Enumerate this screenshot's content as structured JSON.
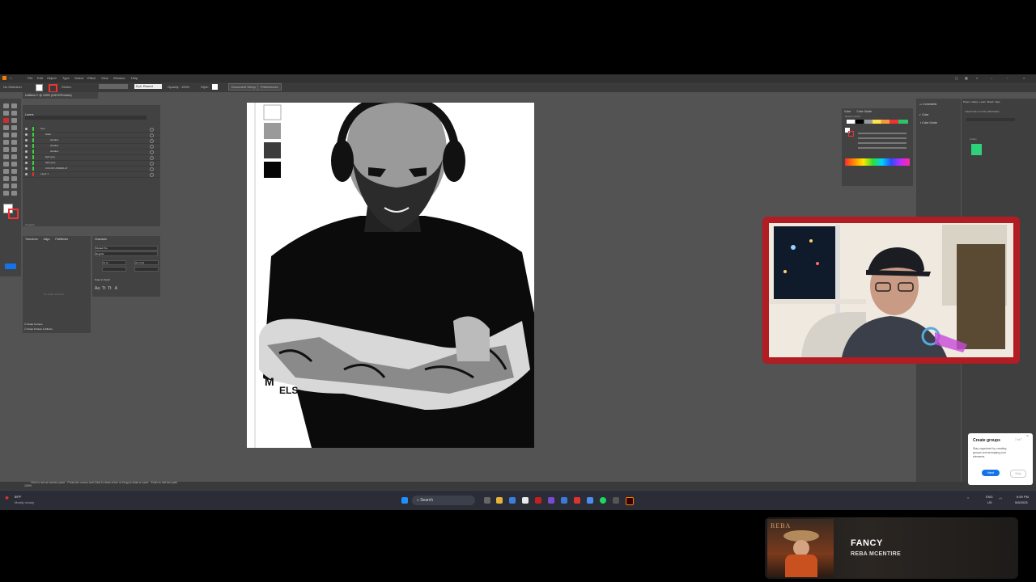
{
  "menu": {
    "items": [
      "File",
      "Edit",
      "Object",
      "Type",
      "Select",
      "Effect",
      "View",
      "Window",
      "Help"
    ]
  },
  "control_bar": {
    "selection": "No Selection",
    "stroke_label": "Stroke:",
    "stroke_style": "5 pt. Round",
    "opacity_label": "Opacity:",
    "opacity_value": "100%",
    "style_label": "Style:",
    "document_setup": "Document Setup",
    "preferences": "Preferences"
  },
  "document_tab": {
    "title": "Untitled-1* @ 100% (CMYK/Preview)"
  },
  "layers_panel": {
    "tab": "Layers",
    "rows": [
      "Text",
      "black",
      "shadow",
      "shadow",
      "shadow",
      "light grey",
      "dark grey",
      "COLOR UNDERLAY",
      "Layer 1"
    ],
    "footer": "2 Layers"
  },
  "properties_panel": {
    "tabs": [
      "Transform",
      "Align",
      "Pathfinder"
    ],
    "empty_note": "No shape selected",
    "scale_corners": "Scale Corners",
    "scale_strokes": "Scale Strokes & Effects"
  },
  "character_panel": {
    "tab": "Character",
    "font": "Myriad Pro",
    "style": "Regular",
    "size": "12 pt",
    "leading": "(14.4 pt)",
    "snap_label": "Snap to Glyph"
  },
  "color_panel": {
    "tabs": [
      "Color",
      "Color Guide"
    ],
    "mode_label": "Recent Colors"
  },
  "right_panels": {
    "items": [
      "Comments",
      "Color",
      "Color Guide"
    ]
  },
  "far_right": {
    "tabs": [
      "Props",
      "Library",
      "Learn",
      "Brush",
      "Type"
    ],
    "heading": "CREATIVE CLOUD LIBRARIES",
    "colors_label": "Colors"
  },
  "status_bar": {
    "zoom": "100%",
    "hint": "Click to set an anchor point · Press the cursor and Click to draw a line or Drag to draw a curve · Enter to exit the path"
  },
  "tooltip": {
    "title": "Create groups",
    "step": "7 of 7",
    "body": "Stay organized by creating groups and arranging your elements.",
    "next": "Next",
    "skip": "Skip"
  },
  "taskbar": {
    "weather_temp": "59°F",
    "weather_desc": "Mostly cloudy",
    "search_placeholder": "Search",
    "lang": "ENG",
    "region": "US",
    "time": "6:59 PM",
    "date": "5/5/2025"
  },
  "now_playing": {
    "title": "FANCY",
    "artist": "REBA MCENTIRE",
    "album_text": "REBA"
  },
  "colors": {
    "webcam_frame": "#b11d22",
    "tooltip_button": "#1473e6",
    "swatch_green": "#2fd07a"
  }
}
